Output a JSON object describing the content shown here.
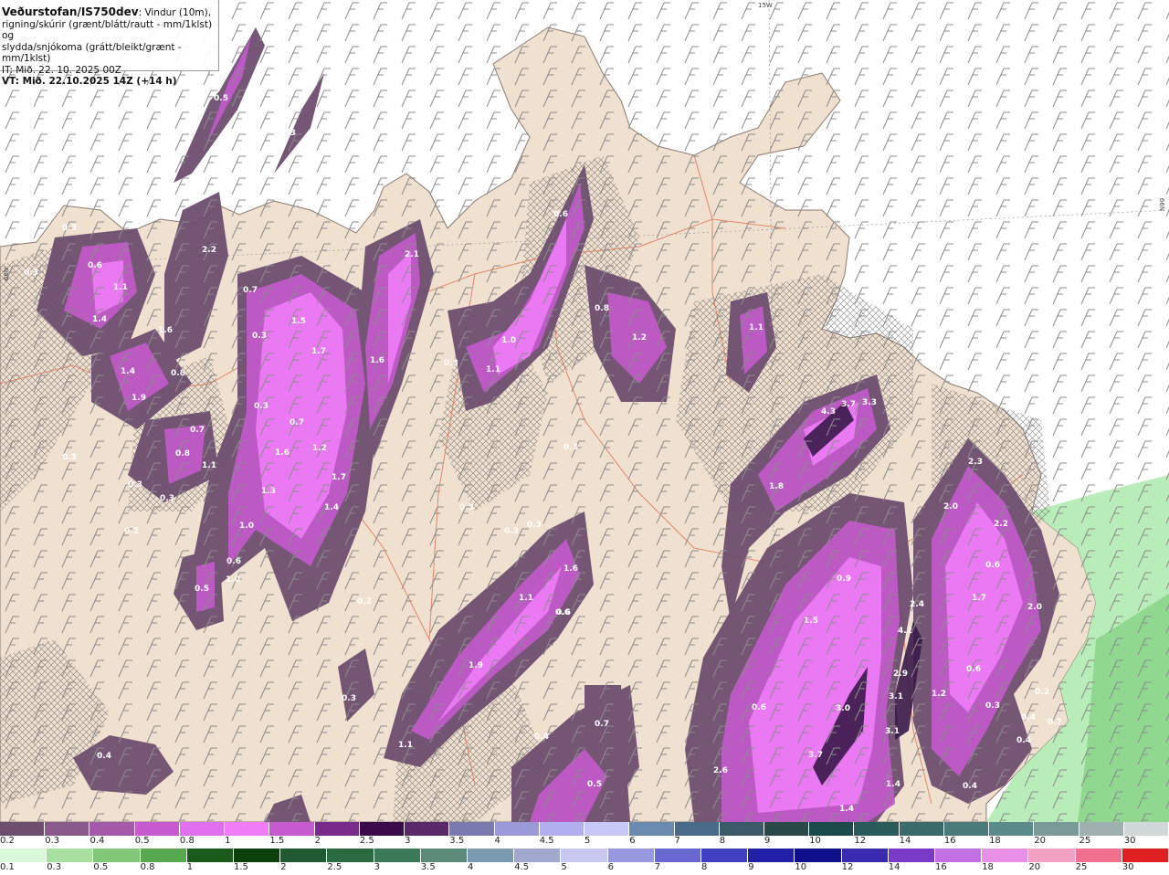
{
  "header": {
    "brand": "Veðurstofan/IS750dev",
    "desc1": ": Vindur (10m),",
    "desc2": "rigning/skúrir (grænt/blátt/rautt - mm/1klst) og",
    "desc3": "slydda/snjókoma (grátt/bleikt/grænt - mm/1klst)",
    "it_line": "IT: Mið. 22. 10. 2025 00Z",
    "vt_line": "VT: Mið. 22.10.2025 14Z (+14 h)"
  },
  "grid_labels": {
    "top": "15W",
    "right": "66N",
    "left": "66N"
  },
  "colors": {
    "land": "#f0e0d0",
    "sea": "#ffffff",
    "snow_light": "#6e4e70",
    "snow_mid": "#c05ac8",
    "snow_bright": "#f07cf8",
    "snow_dark": "#3a1a4a",
    "rain_green": "#a8e8a8",
    "roads": "#e07050"
  },
  "map_values": [
    {
      "t": "0.5"
    },
    {
      "t": "0.3"
    },
    {
      "t": "0.3"
    },
    {
      "t": "0.3"
    },
    {
      "t": "0.6"
    },
    {
      "t": "2.2"
    },
    {
      "t": "1.1"
    },
    {
      "t": "0.7"
    },
    {
      "t": "1.4"
    },
    {
      "t": "1.6"
    },
    {
      "t": "1.5"
    },
    {
      "t": "2.1"
    },
    {
      "t": "0.8"
    },
    {
      "t": "0.6"
    },
    {
      "t": "1.7"
    },
    {
      "t": "1.4"
    },
    {
      "t": "0.8"
    },
    {
      "t": "1.9"
    },
    {
      "t": "0.3"
    },
    {
      "t": "1.0"
    },
    {
      "t": "1.1"
    },
    {
      "t": "1.2"
    },
    {
      "t": "1.1"
    },
    {
      "t": "0.3"
    },
    {
      "t": "0.3"
    },
    {
      "t": "1.6"
    },
    {
      "t": "0.7"
    },
    {
      "t": "0.7"
    },
    {
      "t": "1.6"
    },
    {
      "t": "0.8"
    },
    {
      "t": "1.1"
    },
    {
      "t": "1.2"
    },
    {
      "t": "0.3"
    },
    {
      "t": "0.3"
    },
    {
      "t": "0.3"
    },
    {
      "t": "0.3"
    },
    {
      "t": "4.3"
    },
    {
      "t": "3.7"
    },
    {
      "t": "3.3"
    },
    {
      "t": "1.3"
    },
    {
      "t": "1.7"
    },
    {
      "t": "1.8"
    },
    {
      "t": "2.3"
    },
    {
      "t": "0.3"
    },
    {
      "t": "1.4"
    },
    {
      "t": "2.0"
    },
    {
      "t": "1.0"
    },
    {
      "t": "0.3"
    },
    {
      "t": "0.3"
    },
    {
      "t": "2.2"
    },
    {
      "t": "0.2"
    },
    {
      "t": "0.6"
    },
    {
      "t": "1.6"
    },
    {
      "t": "0.6"
    },
    {
      "t": "1.0"
    },
    {
      "t": "0.9"
    },
    {
      "t": "0.5"
    },
    {
      "t": "1.1"
    },
    {
      "t": "0.2"
    },
    {
      "t": "1.7"
    },
    {
      "t": "2.0"
    },
    {
      "t": "2.4"
    },
    {
      "t": "0.6"
    },
    {
      "t": "1.5"
    },
    {
      "t": "4.2"
    },
    {
      "t": "1.9"
    },
    {
      "t": "2.9"
    },
    {
      "t": "0.6"
    },
    {
      "t": "1.2"
    },
    {
      "t": "3.1"
    },
    {
      "t": "0.3"
    },
    {
      "t": "0.6"
    },
    {
      "t": "3.0"
    },
    {
      "t": "0.4"
    },
    {
      "t": "0.3"
    },
    {
      "t": "0.7"
    },
    {
      "t": "3.1"
    },
    {
      "t": "0.4"
    },
    {
      "t": "1.1"
    },
    {
      "t": "3.7"
    },
    {
      "t": "0.4"
    },
    {
      "t": "0.4"
    },
    {
      "t": "2.6"
    },
    {
      "t": "0.5"
    },
    {
      "t": "1.4"
    },
    {
      "t": "0.4"
    },
    {
      "t": "1.4"
    },
    {
      "t": "0.6"
    },
    {
      "t": "0.7"
    },
    {
      "t": "0.2"
    }
  ],
  "snow_scale": {
    "ticks": [
      "0.2",
      "0.3",
      "0.4",
      "0.5",
      "0.8",
      "1",
      "1.5",
      "2",
      "2.5",
      "3",
      "3.5",
      "4",
      "4.5",
      "5",
      "6",
      "7",
      "8",
      "9",
      "10",
      "12",
      "14",
      "16",
      "18",
      "20",
      "25",
      "30"
    ],
    "colors": [
      "#6e4e6e",
      "#8a5a8c",
      "#a45aa8",
      "#c85ad0",
      "#e070f0",
      "#f07cf8",
      "#c85ad0",
      "#7a2a8a",
      "#3a0a4a",
      "#5a2a6a",
      "#7a7ab0",
      "#9a9ad8",
      "#b0b0f0",
      "#c8c8f8",
      "#6a8ab0",
      "#4a6a8a",
      "#3a5a6a",
      "#2a4a4a",
      "#1a4a4a",
      "#2a5a5a",
      "#3a6a6a",
      "#4a7a7a",
      "#5a8a8a",
      "#7a9a9a",
      "#a0b0b0",
      "#d0d8d8"
    ]
  },
  "rain_scale": {
    "ticks": [
      "0.1",
      "0.3",
      "0.5",
      "0.8",
      "1",
      "1.5",
      "2",
      "2.5",
      "3",
      "3.5",
      "4",
      "4.5",
      "5",
      "6",
      "7",
      "8",
      "9",
      "10",
      "12",
      "14",
      "16",
      "18",
      "20",
      "25",
      "30"
    ],
    "colors": [
      "#d8f8d8",
      "#a8e0a0",
      "#80c878",
      "#58a850",
      "#1a5a1a",
      "#0a400a",
      "#205a30",
      "#2a6a40",
      "#3a7a58",
      "#5a8a78",
      "#7a9ab0",
      "#a0a8d0",
      "#c8c8f0",
      "#9898e0",
      "#6868d0",
      "#4040c0",
      "#2020a8",
      "#10108a",
      "#3a2ab0",
      "#7a3ac8",
      "#c070e0",
      "#e890e8",
      "#f0a0c0",
      "#f07090",
      "#e02020"
    ]
  }
}
